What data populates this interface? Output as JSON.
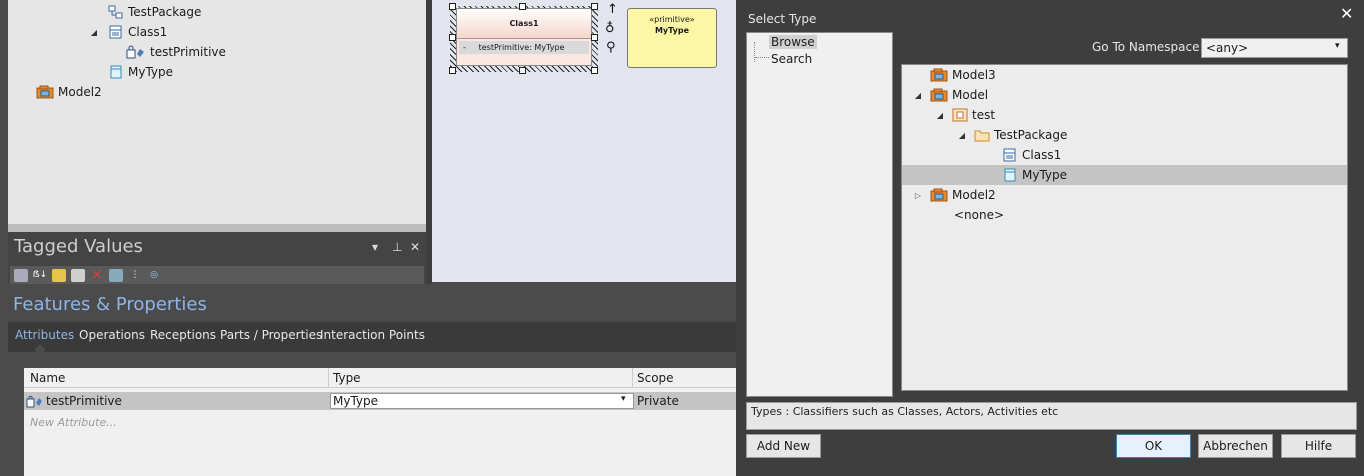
{
  "project_tree": {
    "items": [
      {
        "label": "TestPackage",
        "icon": "package-icon"
      },
      {
        "label": "Class1",
        "icon": "class-icon"
      },
      {
        "label": "testPrimitive",
        "icon": "attribute-icon"
      },
      {
        "label": "MyType",
        "icon": "primitive-icon"
      },
      {
        "label": "Model2",
        "icon": "model-icon"
      }
    ]
  },
  "tagged_values": {
    "title": "Tagged Values"
  },
  "diagram": {
    "class_name": "Class1",
    "class_attr": "-     testPrimitive: MyType",
    "primitive_stereotype": "«primitive»",
    "primitive_name": "MyType"
  },
  "features": {
    "title": "Features & Properties",
    "tabs": [
      "Attributes",
      "Operations",
      "Receptions",
      "Parts / Properties",
      "Interaction Points"
    ],
    "table": {
      "headers": [
        "Name",
        "Type",
        "Scope"
      ],
      "row": {
        "name": "testPrimitive",
        "type": "MyType",
        "scope": "Private"
      },
      "new_placeholder": "New Attribute..."
    }
  },
  "dialog": {
    "title": "Select Type",
    "close": "✕",
    "nav": [
      "Browse",
      "Search"
    ],
    "namespace_label": "Go To Namespace:",
    "namespace_value": "<any>",
    "tree": [
      {
        "label": "Model3",
        "icon": "model-icon"
      },
      {
        "label": "Model",
        "icon": "model-icon"
      },
      {
        "label": "test",
        "icon": "package-icon"
      },
      {
        "label": "TestPackage",
        "icon": "folder-icon"
      },
      {
        "label": "Class1",
        "icon": "class-icon"
      },
      {
        "label": "MyType",
        "icon": "primitive-icon"
      },
      {
        "label": "Model2",
        "icon": "model-icon"
      },
      {
        "label": "<none>",
        "icon": ""
      }
    ],
    "description": "Types : Classifiers such as Classes, Actors, Activities etc",
    "buttons": {
      "add_new": "Add New",
      "ok": "OK",
      "cancel": "Abbrechen",
      "help": "Hilfe"
    }
  },
  "colors": {
    "accent": "#8fb4e6",
    "selection": "#c4c4c4",
    "primitive_fill": "#fbf7a4"
  }
}
